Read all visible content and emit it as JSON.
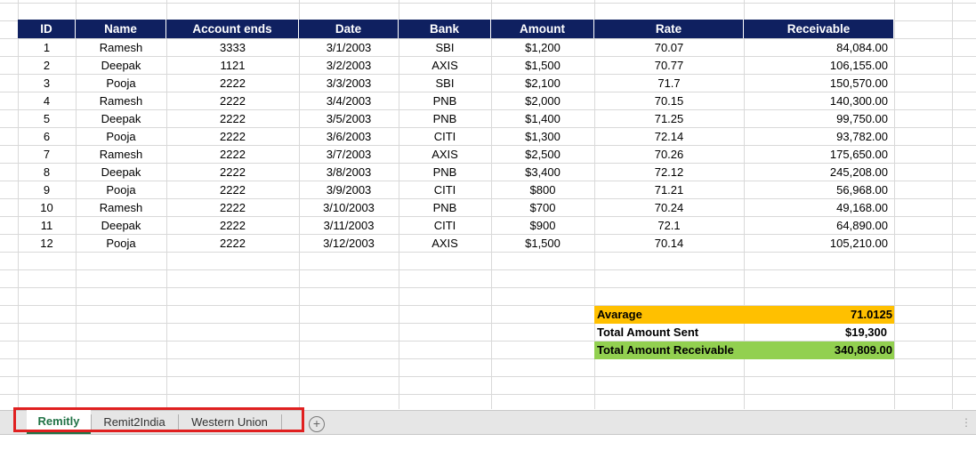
{
  "table": {
    "headers": [
      "ID",
      "Name",
      "Account ends",
      "Date",
      "Bank",
      "Amount",
      "Rate",
      "Receivable"
    ],
    "rows": [
      [
        "1",
        "Ramesh",
        "3333",
        "3/1/2003",
        "SBI",
        "$1,200",
        "70.07",
        "84,084.00"
      ],
      [
        "2",
        "Deepak",
        "1121",
        "3/2/2003",
        "AXIS",
        "$1,500",
        "70.77",
        "106,155.00"
      ],
      [
        "3",
        "Pooja",
        "2222",
        "3/3/2003",
        "SBI",
        "$2,100",
        "71.7",
        "150,570.00"
      ],
      [
        "4",
        "Ramesh",
        "2222",
        "3/4/2003",
        "PNB",
        "$2,000",
        "70.15",
        "140,300.00"
      ],
      [
        "5",
        "Deepak",
        "2222",
        "3/5/2003",
        "PNB",
        "$1,400",
        "71.25",
        "99,750.00"
      ],
      [
        "6",
        "Pooja",
        "2222",
        "3/6/2003",
        "CITI",
        "$1,300",
        "72.14",
        "93,782.00"
      ],
      [
        "7",
        "Ramesh",
        "2222",
        "3/7/2003",
        "AXIS",
        "$2,500",
        "70.26",
        "175,650.00"
      ],
      [
        "8",
        "Deepak",
        "2222",
        "3/8/2003",
        "PNB",
        "$3,400",
        "72.12",
        "245,208.00"
      ],
      [
        "9",
        "Pooja",
        "2222",
        "3/9/2003",
        "CITI",
        "$800",
        "71.21",
        "56,968.00"
      ],
      [
        "10",
        "Ramesh",
        "2222",
        "3/10/2003",
        "PNB",
        "$700",
        "70.24",
        "49,168.00"
      ],
      [
        "11",
        "Deepak",
        "2222",
        "3/11/2003",
        "CITI",
        "$900",
        "72.1",
        "64,890.00"
      ],
      [
        "12",
        "Pooja",
        "2222",
        "3/12/2003",
        "AXIS",
        "$1,500",
        "70.14",
        "105,210.00"
      ]
    ]
  },
  "summary": {
    "average_label": "Avarage",
    "average_value": "71.0125",
    "total_sent_label": "Total Amount Sent",
    "total_sent_value": "$19,300",
    "total_receivable_label": "Total Amount Receivable",
    "total_receivable_value": "340,809.00"
  },
  "sheets": {
    "tabs": [
      "Remitly",
      "Remit2India",
      "Western Union"
    ],
    "active": "Remitly",
    "add_icon": "+",
    "more_icon": "⋮"
  },
  "colors": {
    "header_bg": "#0f2060",
    "average_bg": "#ffc000",
    "receivable_bg": "#92d050",
    "active_tab": "#217346",
    "highlight_border": "#e02020"
  }
}
